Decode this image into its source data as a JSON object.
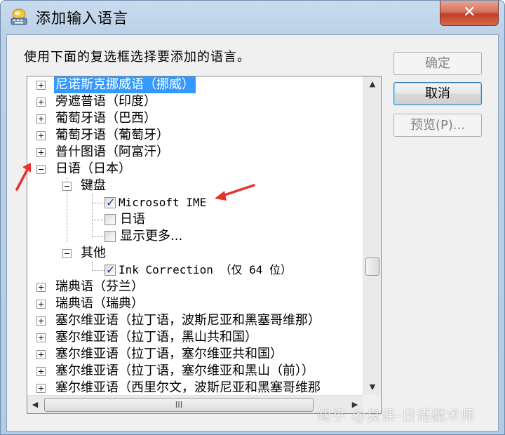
{
  "window": {
    "title": "添加输入语言",
    "close_glyph": "✕"
  },
  "instruction": "使用下面的复选框选择要添加的语言。",
  "buttons": {
    "ok": "确定",
    "cancel": "取消",
    "preview": "预览(P)..."
  },
  "tree": {
    "languages_top": [
      {
        "label": "尼诺斯克挪威语（挪威）",
        "expanded": false,
        "selected": true
      },
      {
        "label": "旁遮普语（印度）",
        "expanded": false
      },
      {
        "label": "葡萄牙语（巴西）",
        "expanded": false
      },
      {
        "label": "葡萄牙语（葡萄牙）",
        "expanded": false
      },
      {
        "label": "普什图语（阿富汗）",
        "expanded": false
      }
    ],
    "japanese": {
      "label": "日语（日本）",
      "keyboard_label": "键盘",
      "keyboard_items": [
        {
          "label": "Microsoft IME",
          "checked": true
        },
        {
          "label": "日语",
          "checked": false
        },
        {
          "label": "显示更多...",
          "checked": false
        }
      ],
      "other_label": "其他",
      "other_items": [
        {
          "label": "Ink Correction （仅 64 位）",
          "checked": true
        }
      ]
    },
    "languages_bottom": [
      {
        "label": "瑞典语（芬兰）"
      },
      {
        "label": "瑞典语（瑞典）"
      },
      {
        "label": "塞尔维亚语（拉丁语，波斯尼亚和黑塞哥维那）"
      },
      {
        "label": "塞尔维亚语（拉丁语，黑山共和国）"
      },
      {
        "label": "塞尔维亚语（拉丁语，塞尔维亚共和国）"
      },
      {
        "label": "塞尔维亚语（拉丁语，塞尔维亚和黑山（前））"
      },
      {
        "label": "塞尔维亚语（西里尔文，波斯尼亚和黑塞哥维那"
      }
    ]
  },
  "scrollbars": {
    "up": "▲",
    "down": "▼",
    "left": "◀",
    "right": "▶",
    "grip": "III"
  },
  "watermark": "知乎 @良课-日语魔术师",
  "annotation_color": "#e8312a"
}
